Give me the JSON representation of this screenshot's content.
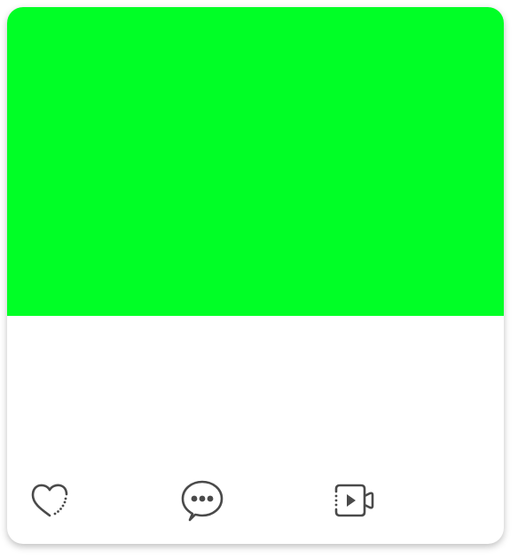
{
  "card": {
    "media": {
      "fill_color": "#00ff26"
    },
    "actions": [
      {
        "name": "like",
        "icon": "heart-icon"
      },
      {
        "name": "comment",
        "icon": "chat-bubble-icon"
      },
      {
        "name": "video",
        "icon": "video-camera-icon"
      }
    ],
    "icon_color": "#4a4a4a"
  }
}
